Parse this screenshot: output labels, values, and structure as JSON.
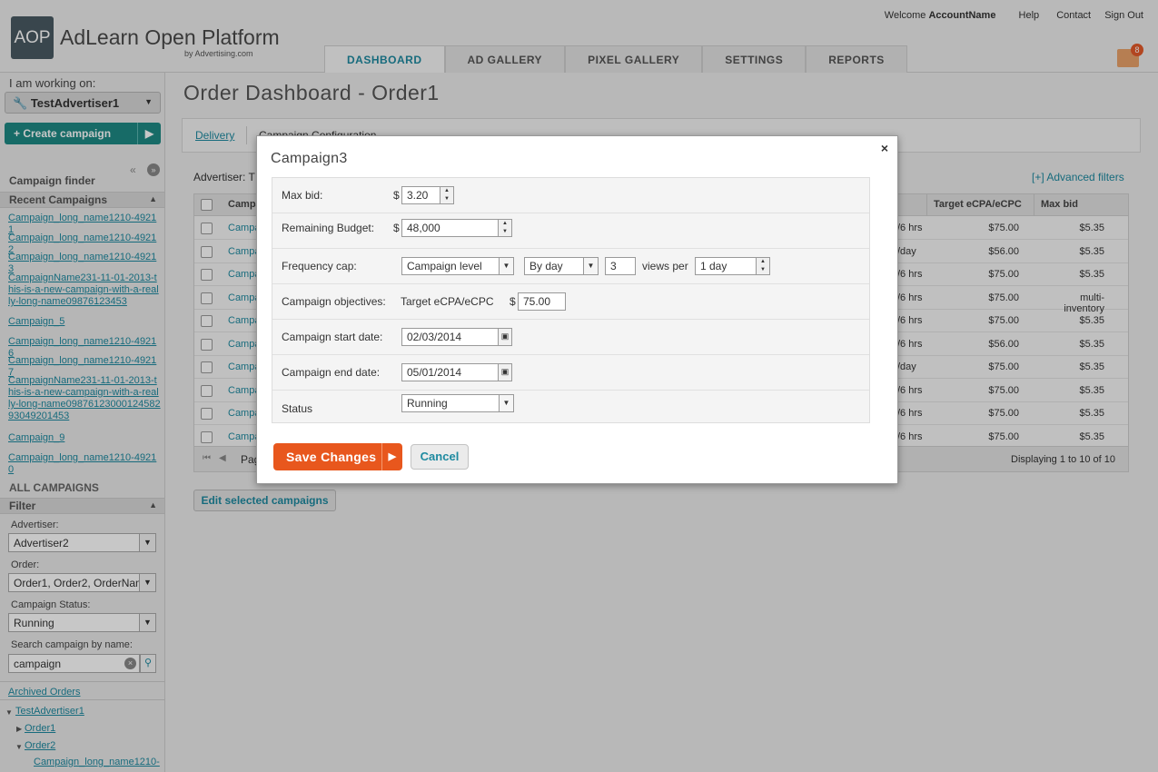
{
  "header": {
    "logo_mark": "AOP",
    "logo_name": "AdLearn Open Platform",
    "logo_sub": "by Advertising.com",
    "welcome": "Welcome",
    "account_name": "AccountName",
    "links": [
      "Help",
      "Contact",
      "Sign Out"
    ],
    "tabs": [
      "DASHBOARD",
      "AD GALLERY",
      "PIXEL GALLERY",
      "SETTINGS",
      "REPORTS"
    ],
    "inbox_count": "8"
  },
  "sidebar": {
    "working_on_label": "I am working on:",
    "working_on_value": "TestAdvertiser1",
    "create_campaign": "+ Create campaign",
    "campaign_finder": "Campaign finder",
    "recent_campaigns": "Recent Campaigns",
    "recent_items": [
      "Campaign_long_name1210-49211",
      "Campaign_long_name1210-49212",
      "Campaign_long_name1210-49213",
      "CampaignName231-11-01-2013-this-is-a-new-campaign-with-a-really-long-name09876123453",
      "Campaign_5",
      "Campaign_long_name1210-49216",
      "Campaign_long_name1210-49217",
      "CampaignName231-11-01-2013-this-is-a-new-campaign-with-a-really-long-name0987612300012458293049201453",
      "Campaign_9",
      "Campaign_long_name1210-49210"
    ],
    "all_campaigns": "ALL CAMPAIGNS",
    "filter": "Filter",
    "advertiser_label": "Advertiser:",
    "advertiser_value": "Advertiser2",
    "order_label": "Order:",
    "order_value": "Order1, Order2, OrderNam",
    "status_label": "Campaign Status:",
    "status_value": "Running",
    "search_label": "Search campaign by name:",
    "search_value": "campaign",
    "archived_orders": "Archived Orders",
    "tree": {
      "advertiser": "TestAdvertiser1",
      "order1": "Order1",
      "order2": "Order2",
      "child": "Campaign_long_name1210-"
    }
  },
  "main": {
    "title": "Order Dashboard - Order1",
    "subtab_delivery": "Delivery",
    "subtab_config": "Campaign Configuration",
    "advertiser_prefix": "Advertiser: T",
    "advanced_filters": "[+] Advanced filters",
    "col_name": "Campa",
    "col_target": "Target eCPA/eCPC",
    "col_maxbid": "Max bid",
    "rows": [
      {
        "name": "Campa",
        "freq": "/6 hrs",
        "target": "$75.00",
        "maxbid": "$5.35"
      },
      {
        "name": "Campa",
        "freq": "/day",
        "target": "$56.00",
        "maxbid": "$5.35"
      },
      {
        "name": "Campa",
        "freq": "/6 hrs",
        "target": "$75.00",
        "maxbid": "$5.35"
      },
      {
        "name": "Campa",
        "freq": "/6 hrs",
        "target": "$75.00",
        "maxbid": "multi-inventory"
      },
      {
        "name": "Campa",
        "freq": "/6 hrs",
        "target": "$75.00",
        "maxbid": "$5.35"
      },
      {
        "name": "Campa",
        "freq": "/6 hrs",
        "target": "$56.00",
        "maxbid": "$5.35"
      },
      {
        "name": "Campa",
        "freq": "/day",
        "target": "$75.00",
        "maxbid": "$5.35"
      },
      {
        "name": "Campa",
        "freq": "/6 hrs",
        "target": "$75.00",
        "maxbid": "$5.35"
      },
      {
        "name": "Campa",
        "freq": "/6 hrs",
        "target": "$75.00",
        "maxbid": "$5.35"
      },
      {
        "name": "Campa",
        "freq": "/6 hrs",
        "target": "$75.00",
        "maxbid": "$5.35"
      }
    ],
    "pager_prefix": "Pag",
    "displaying": "Displaying 1 to 10  of 10",
    "edit_selected": "Edit selected campaigns"
  },
  "modal": {
    "title": "Campaign3",
    "close": "×",
    "currency": "$",
    "max_bid_label": "Max bid:",
    "max_bid_value": "3.20",
    "budget_label": "Remaining Budget:",
    "budget_value": "48,000",
    "freq_label": "Frequency cap:",
    "freq_level": "Campaign level",
    "freq_period": "By day",
    "freq_views": "3",
    "views_per": "views per",
    "freq_window": "1 day",
    "objectives_label": "Campaign objectives:",
    "objectives_type": "Target eCPA/eCPC",
    "objectives_value": "75.00",
    "start_label": "Campaign start date:",
    "start_value": "02/03/2014",
    "end_label": "Campaign end date:",
    "end_value": "05/01/2014",
    "status_label": "Status",
    "status_value": "Running",
    "save": "Save Changes",
    "cancel": "Cancel"
  },
  "colors": {
    "accent": "#1e8aa0",
    "save": "#e8571d",
    "create": "#1e8a85"
  }
}
